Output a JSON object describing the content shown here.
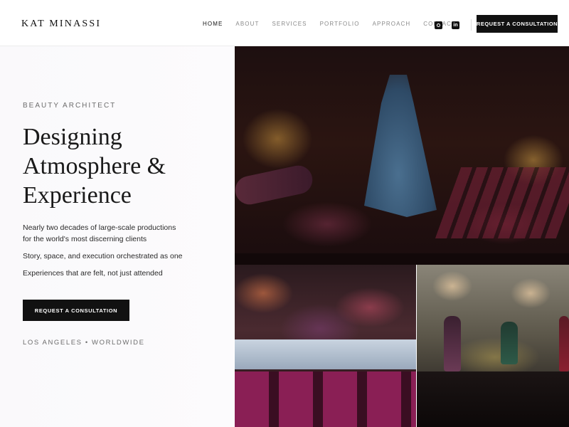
{
  "header": {
    "logo": "KAT MINASSI",
    "nav": [
      {
        "label": "HOME",
        "active": true
      },
      {
        "label": "ABOUT",
        "active": false
      },
      {
        "label": "SERVICES",
        "active": false
      },
      {
        "label": "PORTFOLIO",
        "active": false
      },
      {
        "label": "APPROACH",
        "active": false
      },
      {
        "label": "CONTACT",
        "active": false
      }
    ],
    "social": [
      "instagram-icon",
      "linkedin-icon"
    ],
    "linkedin_glyph": "in",
    "cta_label": "REQUEST A CONSULTATION"
  },
  "hero": {
    "eyebrow": "BEAUTY ARCHITECT",
    "headline": [
      "Designing",
      "Atmosphere &",
      "Experience"
    ],
    "paragraphs": [
      "Nearly two decades of large-scale productions for the world's most discerning clients",
      "Story, space, and execution orchestrated as one",
      "Experiences that are felt, not just attended"
    ],
    "cta_label": "REQUEST A CONSULTATION",
    "locations": "LOS ANGELES • WORLDWIDE"
  },
  "colors": {
    "primary": "#111111",
    "muted": "#8a8a8a",
    "background": "#ffffff"
  }
}
